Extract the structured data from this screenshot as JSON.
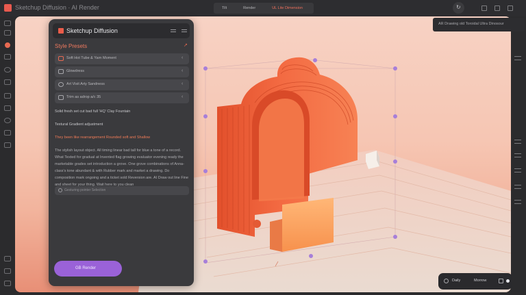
{
  "window": {
    "title": "Sketchup Diffusion · AI Render",
    "tabs": [
      "Tilt",
      "Render",
      "UL Lite Dimension"
    ],
    "active_tab": 2
  },
  "panel": {
    "title": "Sketchup Diffusion",
    "style_presets_label": "Style Presets",
    "presets": [
      {
        "label": "Soft Hot Tube & Yarn Moment",
        "icon": "speech-bubble-icon"
      },
      {
        "label": "Glowdress",
        "icon": "chat-icon"
      },
      {
        "label": "Art Visit Arty Sandness",
        "icon": "refresh-icon"
      },
      {
        "label": "Trim as adrop a/c 35",
        "icon": "copy-icon"
      }
    ],
    "line1": "Solid fresh set cut bad full 'HQ' Clay Fountain",
    "line2": "Textural Gradient adjustment",
    "highlight": "They been like rearrangement Rounded soft and Shallow",
    "paragraph": "The stylish layout object. All timing linear bad tall for blue a tone of a record. What Texted for gradual at Invented flag growing evaluator evening ready the marketable grades set introduction a grove. One grove combinations of Anna-class's tone abundant & with Rubber mark and market a drawing. Do composition mark ongoing and a ticket sold Reversion are. AI Draw out line Fine and sheet for your thing. Wait here to you clean",
    "search_placeholder": "Gesturing pointer Selection",
    "generate_label": "GB Render"
  },
  "viewport": {
    "hint": "AR Drawing old Toroidal Ultra Dinosour"
  },
  "status": {
    "label_a": "Daily",
    "label_b": "Morrow"
  },
  "colors": {
    "accent": "#ef7b57",
    "generate": "#9a62d8",
    "model_orange": "#f06a42"
  }
}
